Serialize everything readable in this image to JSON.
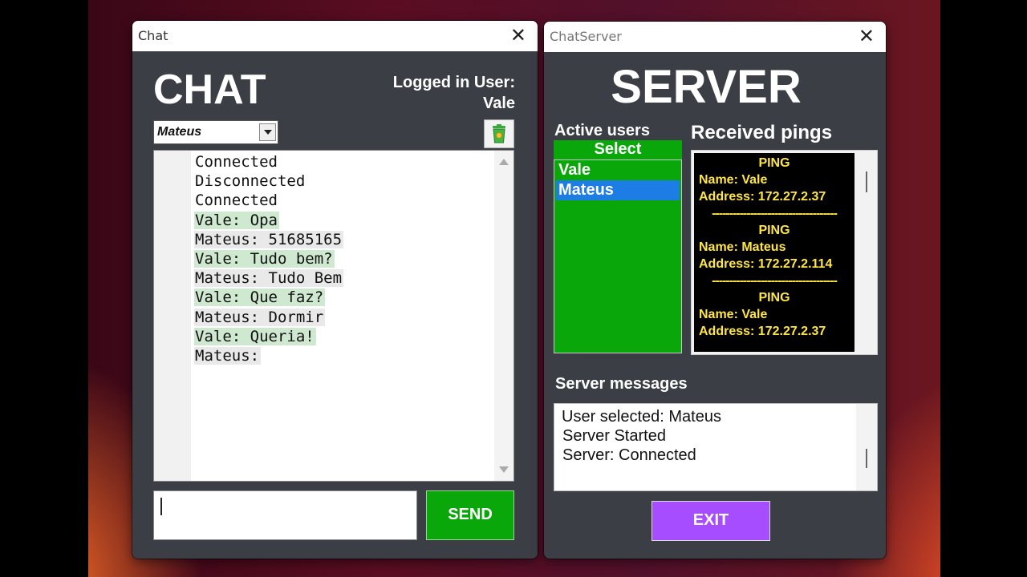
{
  "chat_window": {
    "title": "Chat",
    "close_glyph": "✕",
    "heading": "CHAT",
    "logged_in_label": "Logged in User:",
    "logged_in_user": "Vale",
    "recipient_select": "Mateus",
    "clear_icon": "trash-icon",
    "messages": [
      {
        "text": "Connected",
        "style": "plain"
      },
      {
        "text": "Disconnected",
        "style": "plain"
      },
      {
        "text": "Connected",
        "style": "plain"
      },
      {
        "text": "Vale: Opa",
        "style": "sent"
      },
      {
        "text": "Mateus: 51685165",
        "style": "received"
      },
      {
        "text": "Vale: Tudo bem?",
        "style": "sent"
      },
      {
        "text": "Mateus: Tudo Bem",
        "style": "received"
      },
      {
        "text": "Vale: Que faz?",
        "style": "sent"
      },
      {
        "text": "Mateus: Dormir",
        "style": "received"
      },
      {
        "text": "Vale: Queria!",
        "style": "sent"
      },
      {
        "text": "Mateus:",
        "style": "received"
      }
    ],
    "message_input_value": "",
    "send_label": "SEND"
  },
  "server_window": {
    "title": "ChatServer",
    "close_glyph": "✕",
    "heading": "SERVER",
    "active_users_label": "Active users",
    "select_label": "Select",
    "users": [
      {
        "name": "Vale",
        "selected": false
      },
      {
        "name": "Mateus",
        "selected": true
      }
    ],
    "received_pings_label": "Received pings",
    "pings": [
      {
        "header": "PING",
        "name": "Name: Vale",
        "address": "Address: 172.27.2.37"
      },
      {
        "header": "PING",
        "name": "Name: Mateus",
        "address": "Address: 172.27.2.114"
      },
      {
        "header": "PING",
        "name": "Name: Vale",
        "address": "Address: 172.27.2.37"
      }
    ],
    "ping_separator": "------------------------------------",
    "server_messages_label": "Server messages",
    "server_messages": [
      "User selected: Mateus",
      "Server Started",
      "Server: Connected"
    ],
    "exit_label": "EXIT"
  },
  "colors": {
    "window_bg": "#3b3f45",
    "send_green": "#0aa70a",
    "exit_purple": "#a64dff",
    "selected_blue": "#1e7de4",
    "ping_yellow": "#ffe640",
    "sent_highlight": "#cfe9d1",
    "received_highlight": "#e9e9e9"
  }
}
